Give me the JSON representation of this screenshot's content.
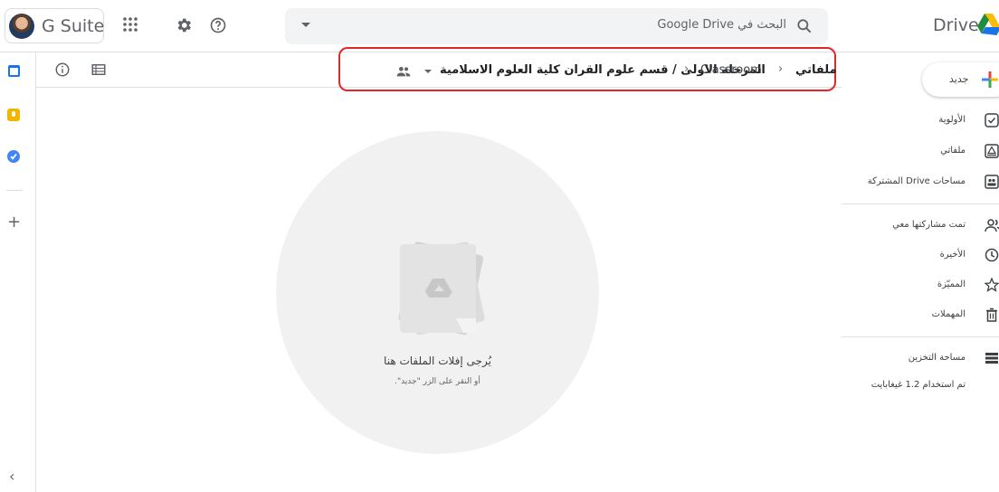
{
  "topbar": {
    "brand": "G Suite",
    "app_title": "Drive",
    "search_placeholder": "البحث في Google Drive"
  },
  "breadcrumb": {
    "items": [
      "ملفاتي",
      "Classroom",
      "المرحلة الاولى / قسم علوم القران كلية العلوم الاسلامية"
    ]
  },
  "sidebar": {
    "new_label": "جديد",
    "items": [
      {
        "label": "الأولوية",
        "icon": "priority-icon"
      },
      {
        "label": "ملفاتي",
        "icon": "my-drive-icon"
      },
      {
        "label": "مساحات Drive المشتركة",
        "icon": "shared-drives-icon"
      },
      {
        "label": "تمت مشاركتها معي",
        "icon": "shared-with-me-icon"
      },
      {
        "label": "الأخيرة",
        "icon": "recent-icon"
      },
      {
        "label": "المميّزة",
        "icon": "starred-icon"
      },
      {
        "label": "المهملات",
        "icon": "trash-icon"
      },
      {
        "label": "مساحة التخزين",
        "icon": "storage-icon"
      }
    ],
    "storage_used": "تم استخدام 1.2 غيغابايت"
  },
  "empty_state": {
    "title": "يُرجى إفلات الملفات هنا",
    "subtitle": "أو النقر على الزر \"جديد\"."
  },
  "colors": {
    "highlight_border": "#e5242b",
    "calendar": "#1a73e8",
    "keep": "#f4b400",
    "tasks": "#4285f4"
  }
}
